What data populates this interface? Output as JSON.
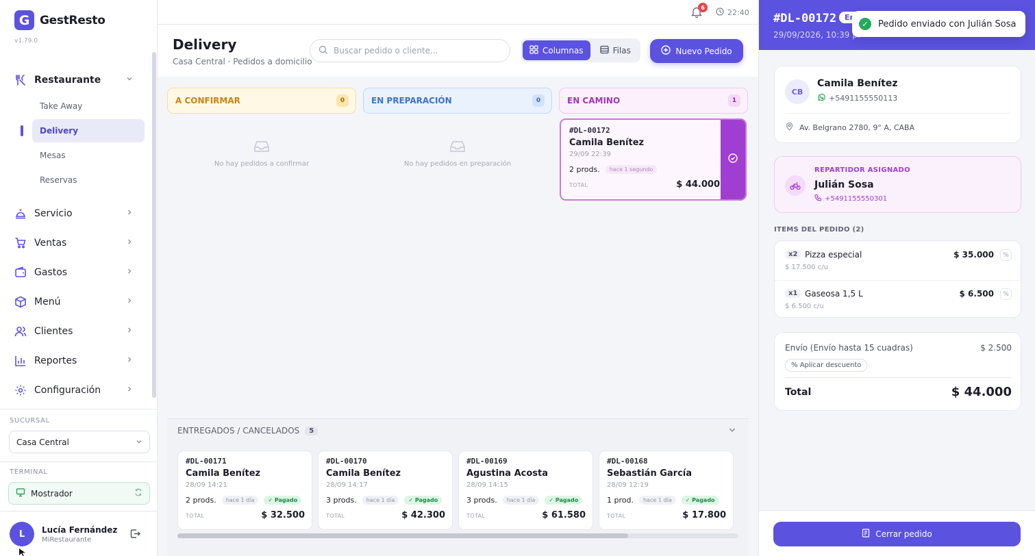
{
  "app": {
    "name": "GestResto",
    "logo_letter": "G",
    "version": "v1.79.0"
  },
  "sidebar": {
    "parent_open": {
      "label": "Restaurante",
      "icon": "utensils-icon"
    },
    "sub_items": [
      {
        "label": "Take Away",
        "active": false
      },
      {
        "label": "Delivery",
        "active": true
      },
      {
        "label": "Mesas",
        "active": false
      },
      {
        "label": "Reservas",
        "active": false
      }
    ],
    "sections": [
      {
        "label": "Servicio",
        "icon": "service-icon"
      },
      {
        "label": "Ventas",
        "icon": "cart-icon"
      },
      {
        "label": "Gastos",
        "icon": "wallet-icon"
      },
      {
        "label": "Menú",
        "icon": "box-icon"
      },
      {
        "label": "Clientes",
        "icon": "users-icon"
      },
      {
        "label": "Reportes",
        "icon": "bar-chart-icon"
      },
      {
        "label": "Configuración",
        "icon": "gear-icon"
      }
    ],
    "branch_label": "SUCURSAL",
    "branch_value": "Casa Central",
    "terminal_label": "TERMINAL",
    "terminal_value": "Mostrador",
    "user": {
      "initial": "L",
      "name": "Lucía Fernández",
      "org": "MiRestaurante"
    }
  },
  "topbar": {
    "notifications": "6",
    "time": "22:40"
  },
  "header": {
    "title": "Delivery",
    "subtitle": "Casa Central · Pedidos a domicilio",
    "search_placeholder": "Buscar pedido o cliente...",
    "view_columns": "Columnas",
    "view_rows": "Filas",
    "new_order": "Nuevo Pedido"
  },
  "columns": [
    {
      "title": "A CONFIRMAR",
      "count": "0",
      "empty": "No hay pedidos a confirmar"
    },
    {
      "title": "EN PREPARACIÓN",
      "count": "0",
      "empty": "No hay pedidos en preparación"
    },
    {
      "title": "EN CAMINO",
      "count": "1"
    }
  ],
  "on_road_order": {
    "code": "#DL-00172",
    "customer": "Camila Benítez",
    "date": "29/09 22:39",
    "products": "2 prods.",
    "ago": "hace 1 segundo",
    "total_label": "TOTAL",
    "total": "$ 44.000"
  },
  "delivered": {
    "title": "ENTREGADOS / CANCELADOS",
    "count": "5",
    "orders": [
      {
        "code": "#DL-00171",
        "customer": "Camila Benítez",
        "date": "28/09 14:21",
        "products": "2 prods.",
        "ago": "hace 1 día",
        "status": "Pagado",
        "total_label": "TOTAL",
        "total": "$ 32.500"
      },
      {
        "code": "#DL-00170",
        "customer": "Camila Benítez",
        "date": "28/09 14:17",
        "products": "3 prods.",
        "ago": "hace 1 día",
        "status": "Pagado",
        "total_label": "TOTAL",
        "total": "$ 42.300"
      },
      {
        "code": "#DL-00169",
        "customer": "Agustina Acosta",
        "date": "28/09 14:15",
        "products": "3 prods.",
        "ago": "hace 1 día",
        "status": "Pagado",
        "total_label": "TOTAL",
        "total": "$ 61.580"
      },
      {
        "code": "#DL-00168",
        "customer": "Sebastián García",
        "date": "28/09 12:19",
        "products": "1 prod.",
        "ago": "hace 1 día",
        "status": "Pagado",
        "total_label": "TOTAL",
        "total": "$ 17.800"
      }
    ]
  },
  "panel": {
    "code": "#DL-00172",
    "badge": "En",
    "date": "29/09/2026, 10:39 p.",
    "toast": "Pedido enviado con Julián Sosa",
    "customer": {
      "initials": "CB",
      "name": "Camila Benítez",
      "phone": "+5491155550113",
      "address": "Av. Belgrano 2780, 9° A, CABA"
    },
    "driver": {
      "label": "REPARTIDOR ASIGNADO",
      "name": "Julián Sosa",
      "phone": "+5491155550301"
    },
    "items_label": "ITEMS DEL PEDIDO (2)",
    "items": [
      {
        "qty": "x2",
        "name": "Pizza especial",
        "unit": "$ 17.500 c/u",
        "price": "$ 35.000"
      },
      {
        "qty": "x1",
        "name": "Gaseosa 1,5 L",
        "unit": "$ 6.500 c/u",
        "price": "$ 6.500"
      }
    ],
    "shipping_label": "Envío (Envío hasta 15 cuadras)",
    "shipping_value": "$ 2.500",
    "discount_label": "Aplicar descuento",
    "total_label": "Total",
    "total_value": "$ 44.000",
    "close_button": "Cerrar pedido"
  }
}
